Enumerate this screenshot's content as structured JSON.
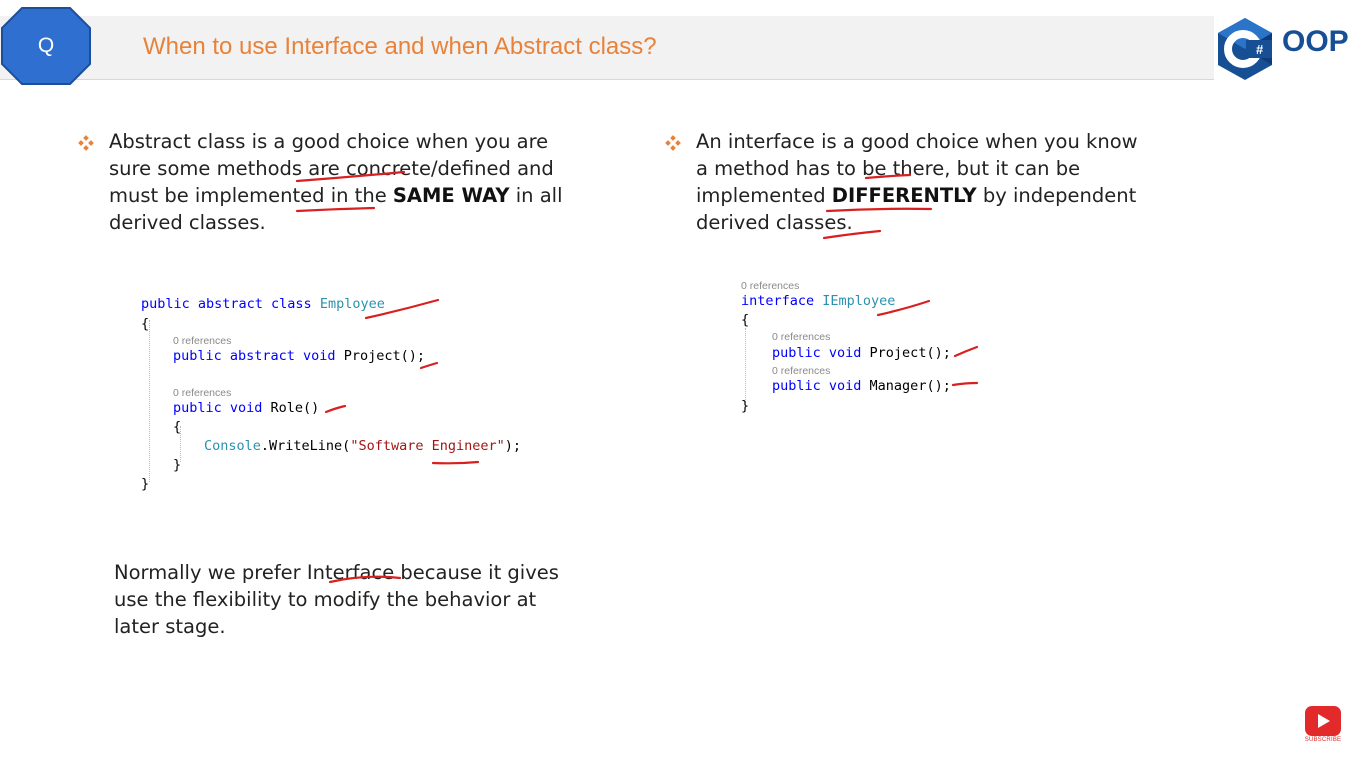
{
  "header": {
    "badge_letter": "Q",
    "title": "When to use Interface and when Abstract class?",
    "logo_glyph": "C#",
    "logo_text": "OOP",
    "brand_color": "#174f95",
    "title_color": "#e8823a"
  },
  "left": {
    "bullet_icon": "diamond-bullet-icon",
    "text_part1": "Abstract class is a good choice when you are sure some methods are concrete/defined and must be implemented in the ",
    "text_bold": "SAME WAY",
    "text_part2": " in all derived classes.",
    "code": {
      "l1_kw": "public abstract class ",
      "l1_type": "Employee",
      "l2": "{",
      "ref1": "0 references",
      "l3_kw": "public abstract void ",
      "l3_rest": "Project();",
      "ref2": "0 references",
      "l4_kw": "public void ",
      "l4_rest": "Role()",
      "l5": "{",
      "l6_type": "Console",
      "l6_mid": ".WriteLine(",
      "l6_str": "\"Software Engineer\"",
      "l6_end": ");",
      "l7": "}",
      "l8": "}"
    }
  },
  "right": {
    "bullet_icon": "diamond-bullet-icon",
    "text_part1": "An interface is a good choice when you know a method has to be there, but it can be implemented ",
    "text_bold": "DIFFERENTLY",
    "text_part2": " by independent derived classes.",
    "code": {
      "ref0": "0 references",
      "l1_kw": "interface ",
      "l1_type": "IEmployee",
      "l2": "{",
      "ref1": "0 references",
      "l3_kw": "public void ",
      "l3_rest": "Project();",
      "ref2": "0 references",
      "l4_kw": "public void ",
      "l4_rest": "Manager();",
      "l5": "}"
    }
  },
  "conclusion": {
    "text": "Normally we prefer Interface because it gives use the flexibility to modify the behavior at later stage."
  },
  "youtube": {
    "icon": "play-icon",
    "label": "SUBSCRIBE"
  }
}
